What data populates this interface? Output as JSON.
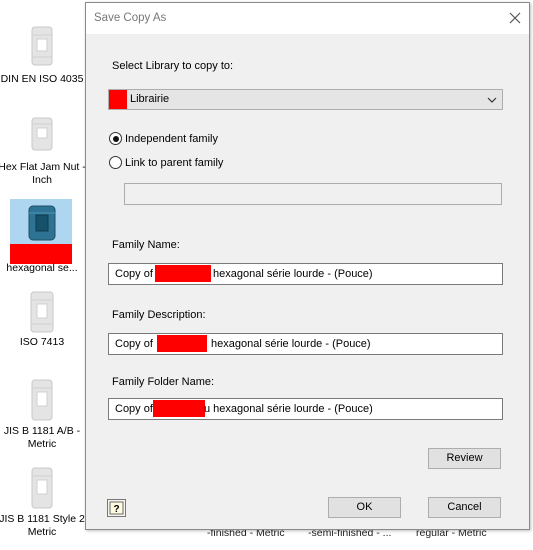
{
  "library_panel": {
    "items": [
      {
        "caption_line1": "DIN EN ISO 4035",
        "caption_line2": ""
      },
      {
        "caption_line1": "Hex Flat Jam Nut -",
        "caption_line2": "Inch"
      },
      {
        "caption_line1": "hexagonal se...",
        "caption_line2": ""
      },
      {
        "caption_line1": "ISO 7413",
        "caption_line2": ""
      },
      {
        "caption_line1": "JIS B 1181 A/B -",
        "caption_line2": "Metric"
      },
      {
        "caption_line1": "JIS B 1181 Style 2",
        "caption_line2": "Metric"
      }
    ],
    "bottom_captions": [
      "-finished - Metric",
      "-semi-finished - ...",
      "regular - Metric"
    ]
  },
  "dialog": {
    "title": "Save Copy As",
    "select_library_label": "Select Library to copy to:",
    "library_value": "Librairie",
    "independent_family_label": "Independent family",
    "link_parent_label": "Link to parent family",
    "independent_selected": true,
    "family_name_label": "Family Name:",
    "family_name_prefix": "Copy of",
    "family_name_suffix": "hexagonal série lourde - (Pouce)",
    "family_description_label": "Family Description:",
    "family_description_prefix": "Copy of",
    "family_description_suffix": "hexagonal série lourde - (Pouce)",
    "family_folder_label": "Family Folder Name:",
    "family_folder_prefix": "Copy of",
    "family_folder_suffix": "u hexagonal série lourde - (Pouce)",
    "review_label": "Review",
    "ok_label": "OK",
    "cancel_label": "Cancel",
    "help_label": "?"
  },
  "colors": {
    "redaction": "#ff0000",
    "selected_thumb_bg": "#aed6f1"
  },
  "icons": {
    "close": "close-icon",
    "dropdown": "chevron-down-icon",
    "help": "help-icon",
    "nut": "hex-nut-icon"
  }
}
